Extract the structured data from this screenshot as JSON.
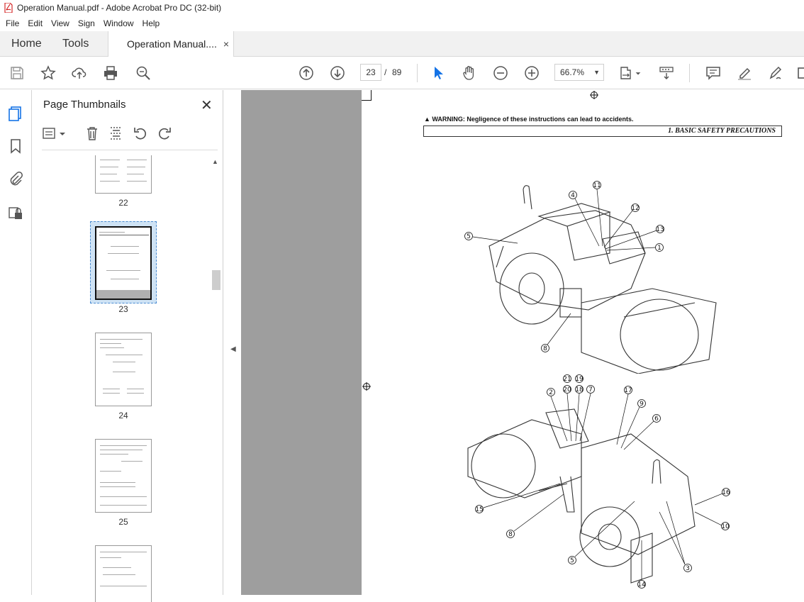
{
  "window": {
    "title": "Operation Manual.pdf - Adobe Acrobat Pro DC (32-bit)"
  },
  "menu": [
    "File",
    "Edit",
    "View",
    "Sign",
    "Window",
    "Help"
  ],
  "tabs": {
    "home": "Home",
    "tools": "Tools",
    "document": "Operation Manual....",
    "close": "×"
  },
  "toolbar": {
    "page_current": "23",
    "page_sep": "/",
    "page_total": "89",
    "zoom": "66.7%"
  },
  "panel": {
    "title": "Page Thumbnails",
    "close": "✕",
    "thumbnails": [
      {
        "label": "22"
      },
      {
        "label": "23",
        "selected": true
      },
      {
        "label": "24"
      },
      {
        "label": "25"
      },
      {
        "label": ""
      }
    ]
  },
  "document": {
    "warning": "WARNING: Negligence of these instructions can lead to accidents.",
    "section": "1. BASIC SAFETY PRECAUTIONS",
    "callouts_top": [
      "4",
      "11",
      "12",
      "13",
      "5",
      "1",
      "8"
    ],
    "callouts_bottom": [
      "21",
      "19",
      "20",
      "18",
      "2",
      "7",
      "17",
      "9",
      "6",
      "16",
      "15",
      "10",
      "8",
      "5",
      "3",
      "14"
    ]
  },
  "colors": {
    "accent": "#1473e6",
    "panel_selected": "#cfe3f5",
    "grey_canvas": "#9e9e9e"
  }
}
